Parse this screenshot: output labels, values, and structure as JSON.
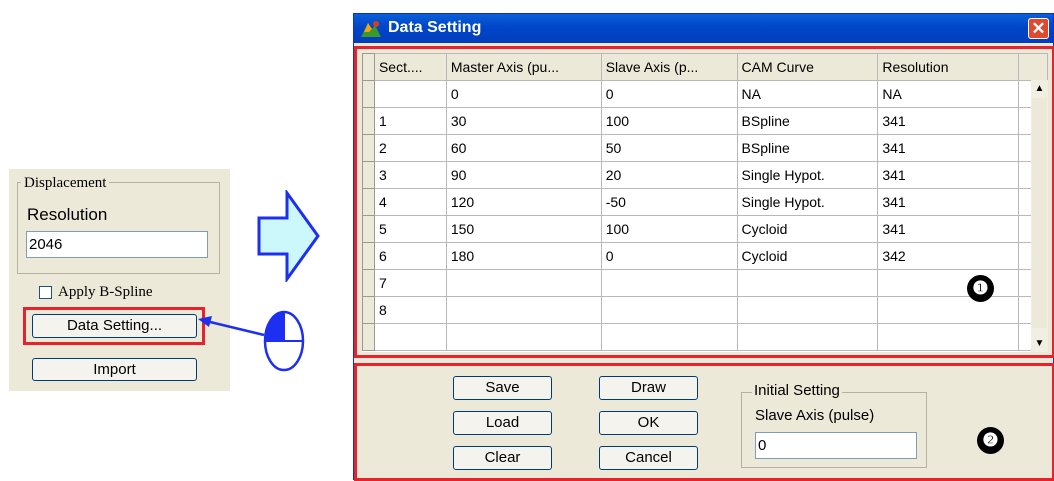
{
  "left_panel": {
    "group_title": "Displacement",
    "resolution_label": "Resolution",
    "resolution_value": "2046",
    "apply_bspline_label": "Apply B-Spline",
    "data_setting_button": "Data Setting...",
    "import_button": "Import"
  },
  "dialog": {
    "title": "Data Setting",
    "close_glyph": "✕",
    "grid": {
      "columns": [
        "Sect....",
        "Master Axis (pu...",
        "Slave Axis (p...",
        "CAM Curve",
        "Resolution"
      ],
      "rows": [
        [
          "",
          "0",
          "0",
          "NA",
          "NA"
        ],
        [
          "1",
          "30",
          "100",
          "BSpline",
          "341"
        ],
        [
          "2",
          "60",
          "50",
          "BSpline",
          "341"
        ],
        [
          "3",
          "90",
          "20",
          "Single Hypot.",
          "341"
        ],
        [
          "4",
          "120",
          "-50",
          "Single Hypot.",
          "341"
        ],
        [
          "5",
          "150",
          "100",
          "Cycloid",
          "341"
        ],
        [
          "6",
          "180",
          "0",
          "Cycloid",
          "342"
        ],
        [
          "7",
          "",
          "",
          "",
          ""
        ],
        [
          "8",
          "",
          "",
          "",
          ""
        ],
        [
          "",
          "",
          "",
          "",
          ""
        ]
      ],
      "scroll_up_glyph": "▲",
      "scroll_down_glyph": "▼"
    },
    "buttons": {
      "save": "Save",
      "load": "Load",
      "clear": "Clear",
      "draw": "Draw",
      "ok": "OK",
      "cancel": "Cancel"
    },
    "initial_setting": {
      "title": "Initial Setting",
      "slave_label": "Slave Axis (pulse)",
      "slave_value": "0"
    }
  },
  "annotations": {
    "badge1": "❶",
    "badge2": "❷",
    "accent_red": "#e8222a",
    "arrow_fill": "#ccf7fb",
    "arrow_stroke": "#1d2ff0",
    "titlebar_blue": "#0046c8"
  }
}
